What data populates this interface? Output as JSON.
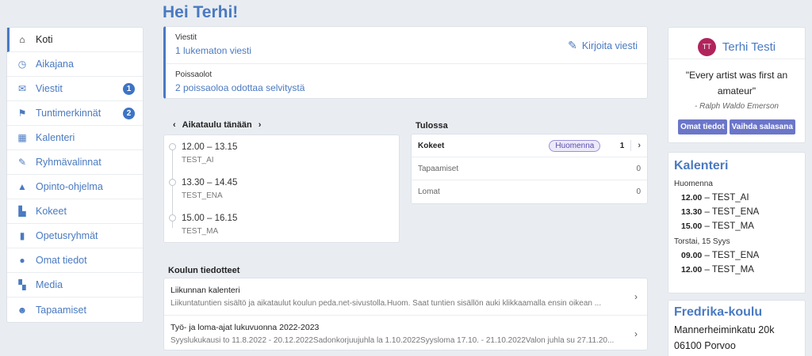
{
  "greeting": "Hei Terhi!",
  "sidebar": {
    "items": [
      {
        "label": "Koti",
        "icon": "home-icon",
        "active": true
      },
      {
        "label": "Aikajana",
        "icon": "clock-icon"
      },
      {
        "label": "Viestit",
        "icon": "envelope-icon",
        "badge": "1"
      },
      {
        "label": "Tuntimerkinnät",
        "icon": "flag-icon",
        "badge": "2"
      },
      {
        "label": "Kalenteri",
        "icon": "calendar-icon"
      },
      {
        "label": "Ryhmävalinnat",
        "icon": "pencil-icon"
      },
      {
        "label": "Opinto-ohjelma",
        "icon": "graduation-cap-icon"
      },
      {
        "label": "Kokeet",
        "icon": "document-icon"
      },
      {
        "label": "Opetusryhmät",
        "icon": "book-icon"
      },
      {
        "label": "Omat tiedot",
        "icon": "user-icon"
      },
      {
        "label": "Media",
        "icon": "media-icon"
      },
      {
        "label": "Tapaamiset",
        "icon": "users-icon"
      }
    ]
  },
  "notifications": {
    "messages_title": "Viestit",
    "messages_link": "1 lukematon viesti",
    "write_message": "Kirjoita viesti",
    "absences_title": "Poissaolot",
    "absences_link": "2 poissaoloa odottaa selvitystä"
  },
  "schedule": {
    "title": "Aikataulu tänään",
    "slots": [
      {
        "time": "12.00 – 13.15",
        "course": "TEST_AI"
      },
      {
        "time": "13.30 – 14.45",
        "course": "TEST_ENA"
      },
      {
        "time": "15.00 – 16.15",
        "course": "TEST_MA"
      }
    ]
  },
  "upcoming": {
    "title": "Tulossa",
    "rows": [
      {
        "label": "Kokeet",
        "tag": "Huomenna",
        "count": "1"
      },
      {
        "label": "Tapaamiset",
        "count": "0"
      },
      {
        "label": "Lomat",
        "count": "0"
      }
    ]
  },
  "news": {
    "title": "Koulun tiedotteet",
    "items": [
      {
        "title": "Liikunnan kalenteri",
        "body": "Liikuntatuntien sisältö ja aikataulut koulun peda.net-sivustolla.Huom. Saat tuntien sisällön auki klikkaamalla ensin oikean ..."
      },
      {
        "title": "Työ- ja loma-ajat lukuvuonna 2022-2023",
        "body": "Syyslukukausi to 11.8.2022 - 20.12.2022Sadonkorjuujuhla la 1.10.2022Syysloma 17.10. - 21.10.2022Valon juhla su 27.11.20..."
      }
    ]
  },
  "profile": {
    "initials": "TT",
    "name": "Terhi Testi",
    "quote": "\"Every artist was first an amateur\"",
    "author": "- Ralph Waldo Emerson",
    "btn_info": "Omat tiedot",
    "btn_password": "Vaihda salasana"
  },
  "calendar": {
    "title": "Kalenteri",
    "days": [
      {
        "label": "Huomenna",
        "entries": [
          {
            "time": "12.00",
            "course": "TEST_AI"
          },
          {
            "time": "13.30",
            "course": "TEST_ENA"
          },
          {
            "time": "15.00",
            "course": "TEST_MA"
          }
        ]
      },
      {
        "label": "Torstai, 15 Syys",
        "entries": [
          {
            "time": "09.00",
            "course": "TEST_ENA"
          },
          {
            "time": "12.00",
            "course": "TEST_MA"
          }
        ]
      }
    ]
  },
  "school": {
    "name": "Fredrika-koulu",
    "street": "Mannerheiminkatu 20k",
    "city": "06100 Porvoo"
  },
  "colors": {
    "accent": "#4a7ac1",
    "badge": "#3d74c4",
    "avatar": "#b0245c",
    "button": "#6b76c9"
  }
}
